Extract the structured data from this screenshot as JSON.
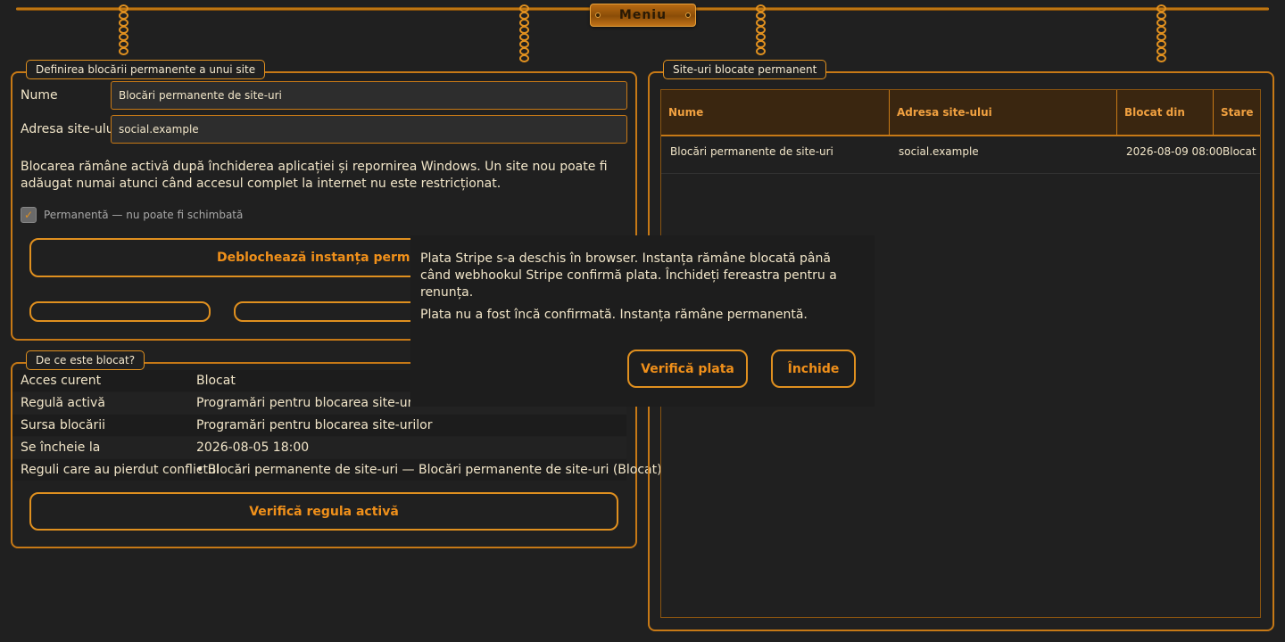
{
  "menu": {
    "label": "Meniu"
  },
  "definition": {
    "title": "Definirea blocării permanente a unui site",
    "name_label": "Nume",
    "name_value": "Blocări permanente de site-uri",
    "address_label": "Adresa site-ului",
    "address_value": "social.example",
    "info": "Blocarea rămâne activă după închiderea aplicației și repornirea Windows. Un site nou poate fi adăugat numai atunci când accesul complet la internet nu este restricționat.",
    "permanent_checked": true,
    "permanent_label": "Permanentă — nu poate fi schimbată",
    "unlock_button": "Deblochează instanța permane",
    "small_button_1": "",
    "small_button_2": ""
  },
  "why": {
    "title": "De ce este blocat?",
    "rows": [
      {
        "label": "Acces curent",
        "value": "Blocat"
      },
      {
        "label": "Regulă activă",
        "value": "Programări pentru blocarea site-urilor"
      },
      {
        "label": "Sursa blocării",
        "value": "Programări pentru blocarea site-urilor"
      },
      {
        "label": "Se încheie la",
        "value": "2026-08-05 18:00"
      },
      {
        "label": "Reguli care au pierdut conflictul",
        "value": "• Blocări permanente de site-uri — Blocări permanente de site-uri (Blocat)"
      }
    ],
    "check_button": "Verifică regula activă"
  },
  "blocked_sites": {
    "title": "Site-uri blocate permanent",
    "columns": [
      "Nume",
      "Adresa site-ului",
      "Blocat din",
      "Stare"
    ],
    "rows": [
      [
        "Blocări permanente de site-uri",
        "social.example",
        "2026-08-09 08:00",
        "Blocat"
      ]
    ]
  },
  "dialog": {
    "message": "Plata Stripe s-a deschis în browser. Instanța rămâne blocată până când webhookul Stripe confirmă plata. Închideți fereastra pentru a renunța.",
    "status": "Plata nu a fost încă confirmată. Instanța rămâne permanentă.",
    "verify_button": "Verifică plata",
    "close_button": "Închide"
  },
  "colors": {
    "accent": "#e0901f",
    "background": "#202020",
    "text": "#f2e6c9"
  }
}
